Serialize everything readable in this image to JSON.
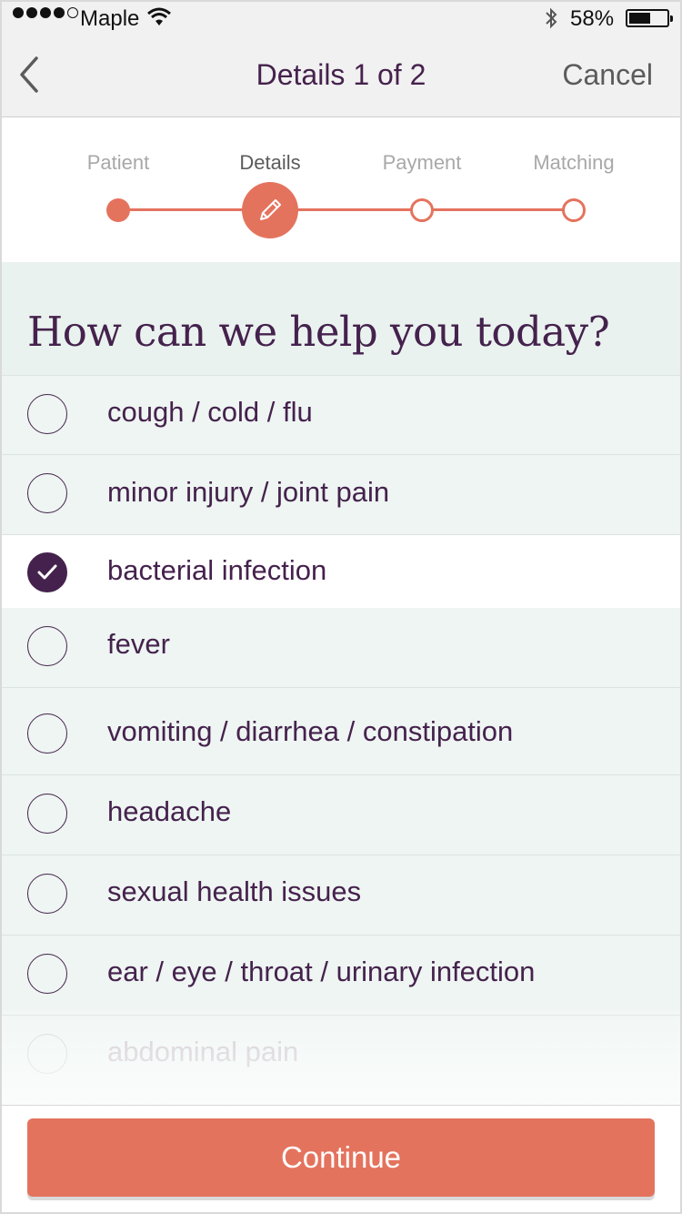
{
  "status_bar": {
    "carrier": "Maple",
    "battery_percent": "58%",
    "signal_bars": 4,
    "signal_total": 5,
    "battery_level": 0.58
  },
  "nav": {
    "title": "Details 1 of 2",
    "cancel_label": "Cancel",
    "back_icon": "chevron-left-icon"
  },
  "stepper": {
    "steps": [
      {
        "label": "Patient",
        "state": "complete"
      },
      {
        "label": "Details",
        "state": "current"
      },
      {
        "label": "Payment",
        "state": "pending"
      },
      {
        "label": "Matching",
        "state": "pending"
      }
    ],
    "current_icon": "pencil-icon",
    "accent_color": "#e4735e"
  },
  "question": {
    "title": "How can we help you today?"
  },
  "options": [
    {
      "label": "cough / cold / flu",
      "selected": false
    },
    {
      "label": "minor injury / joint pain",
      "selected": false
    },
    {
      "label": "bacterial infection",
      "selected": true
    },
    {
      "label": "fever",
      "selected": false
    },
    {
      "label": "vomiting / diarrhea / constipation",
      "selected": false
    },
    {
      "label": "headache",
      "selected": false
    },
    {
      "label": "sexual health issues",
      "selected": false
    },
    {
      "label": "ear / eye / throat / urinary infection",
      "selected": false
    },
    {
      "label": "abdominal pain",
      "selected": false
    }
  ],
  "footer": {
    "continue_label": "Continue"
  },
  "colors": {
    "primary_text": "#45224d",
    "accent": "#e4735e",
    "list_bg": "#eef5f2"
  }
}
